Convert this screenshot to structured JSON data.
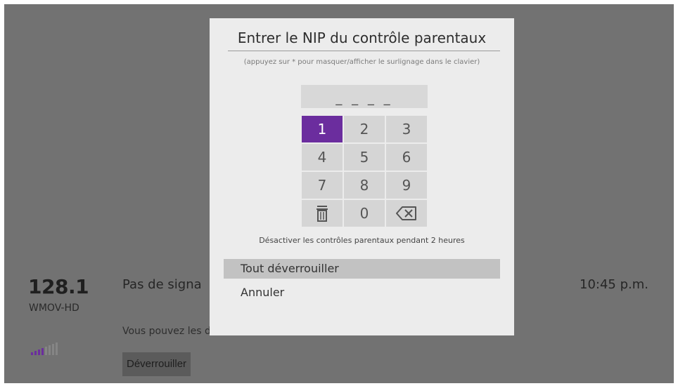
{
  "channel": {
    "number": "128.1",
    "name": "WMOV-HD",
    "message": "Pas de signa",
    "hint": "Vous pouvez les déverrouiller ou modifier les chaînes.",
    "unlock_label": "Déverrouiller",
    "time": "10:45 p.m.",
    "signal_bars_active": 4,
    "signal_bars_total": 8,
    "accent_color": "#6b2d9e"
  },
  "dialog": {
    "title": "Entrer le NIP du contrôle parentaux",
    "subtitle": "(appuyez sur * pour masquer/afficher le surlignage dans le clavier)",
    "pin_placeholder": "_ _ _ _",
    "keys": [
      {
        "label": "1",
        "icon": null
      },
      {
        "label": "2",
        "icon": null
      },
      {
        "label": "3",
        "icon": null
      },
      {
        "label": "4",
        "icon": null
      },
      {
        "label": "5",
        "icon": null
      },
      {
        "label": "6",
        "icon": null
      },
      {
        "label": "7",
        "icon": null
      },
      {
        "label": "8",
        "icon": null
      },
      {
        "label": "9",
        "icon": null
      },
      {
        "label": "",
        "icon": "trash-icon"
      },
      {
        "label": "0",
        "icon": null
      },
      {
        "label": "",
        "icon": "backspace-icon"
      }
    ],
    "selected_key": "1",
    "disable_text": "Désactiver les contrôles parentaux pendant 2 heures",
    "menu": [
      {
        "label": "Tout déverrouiller",
        "selected": true
      },
      {
        "label": "Annuler",
        "selected": false
      }
    ]
  }
}
